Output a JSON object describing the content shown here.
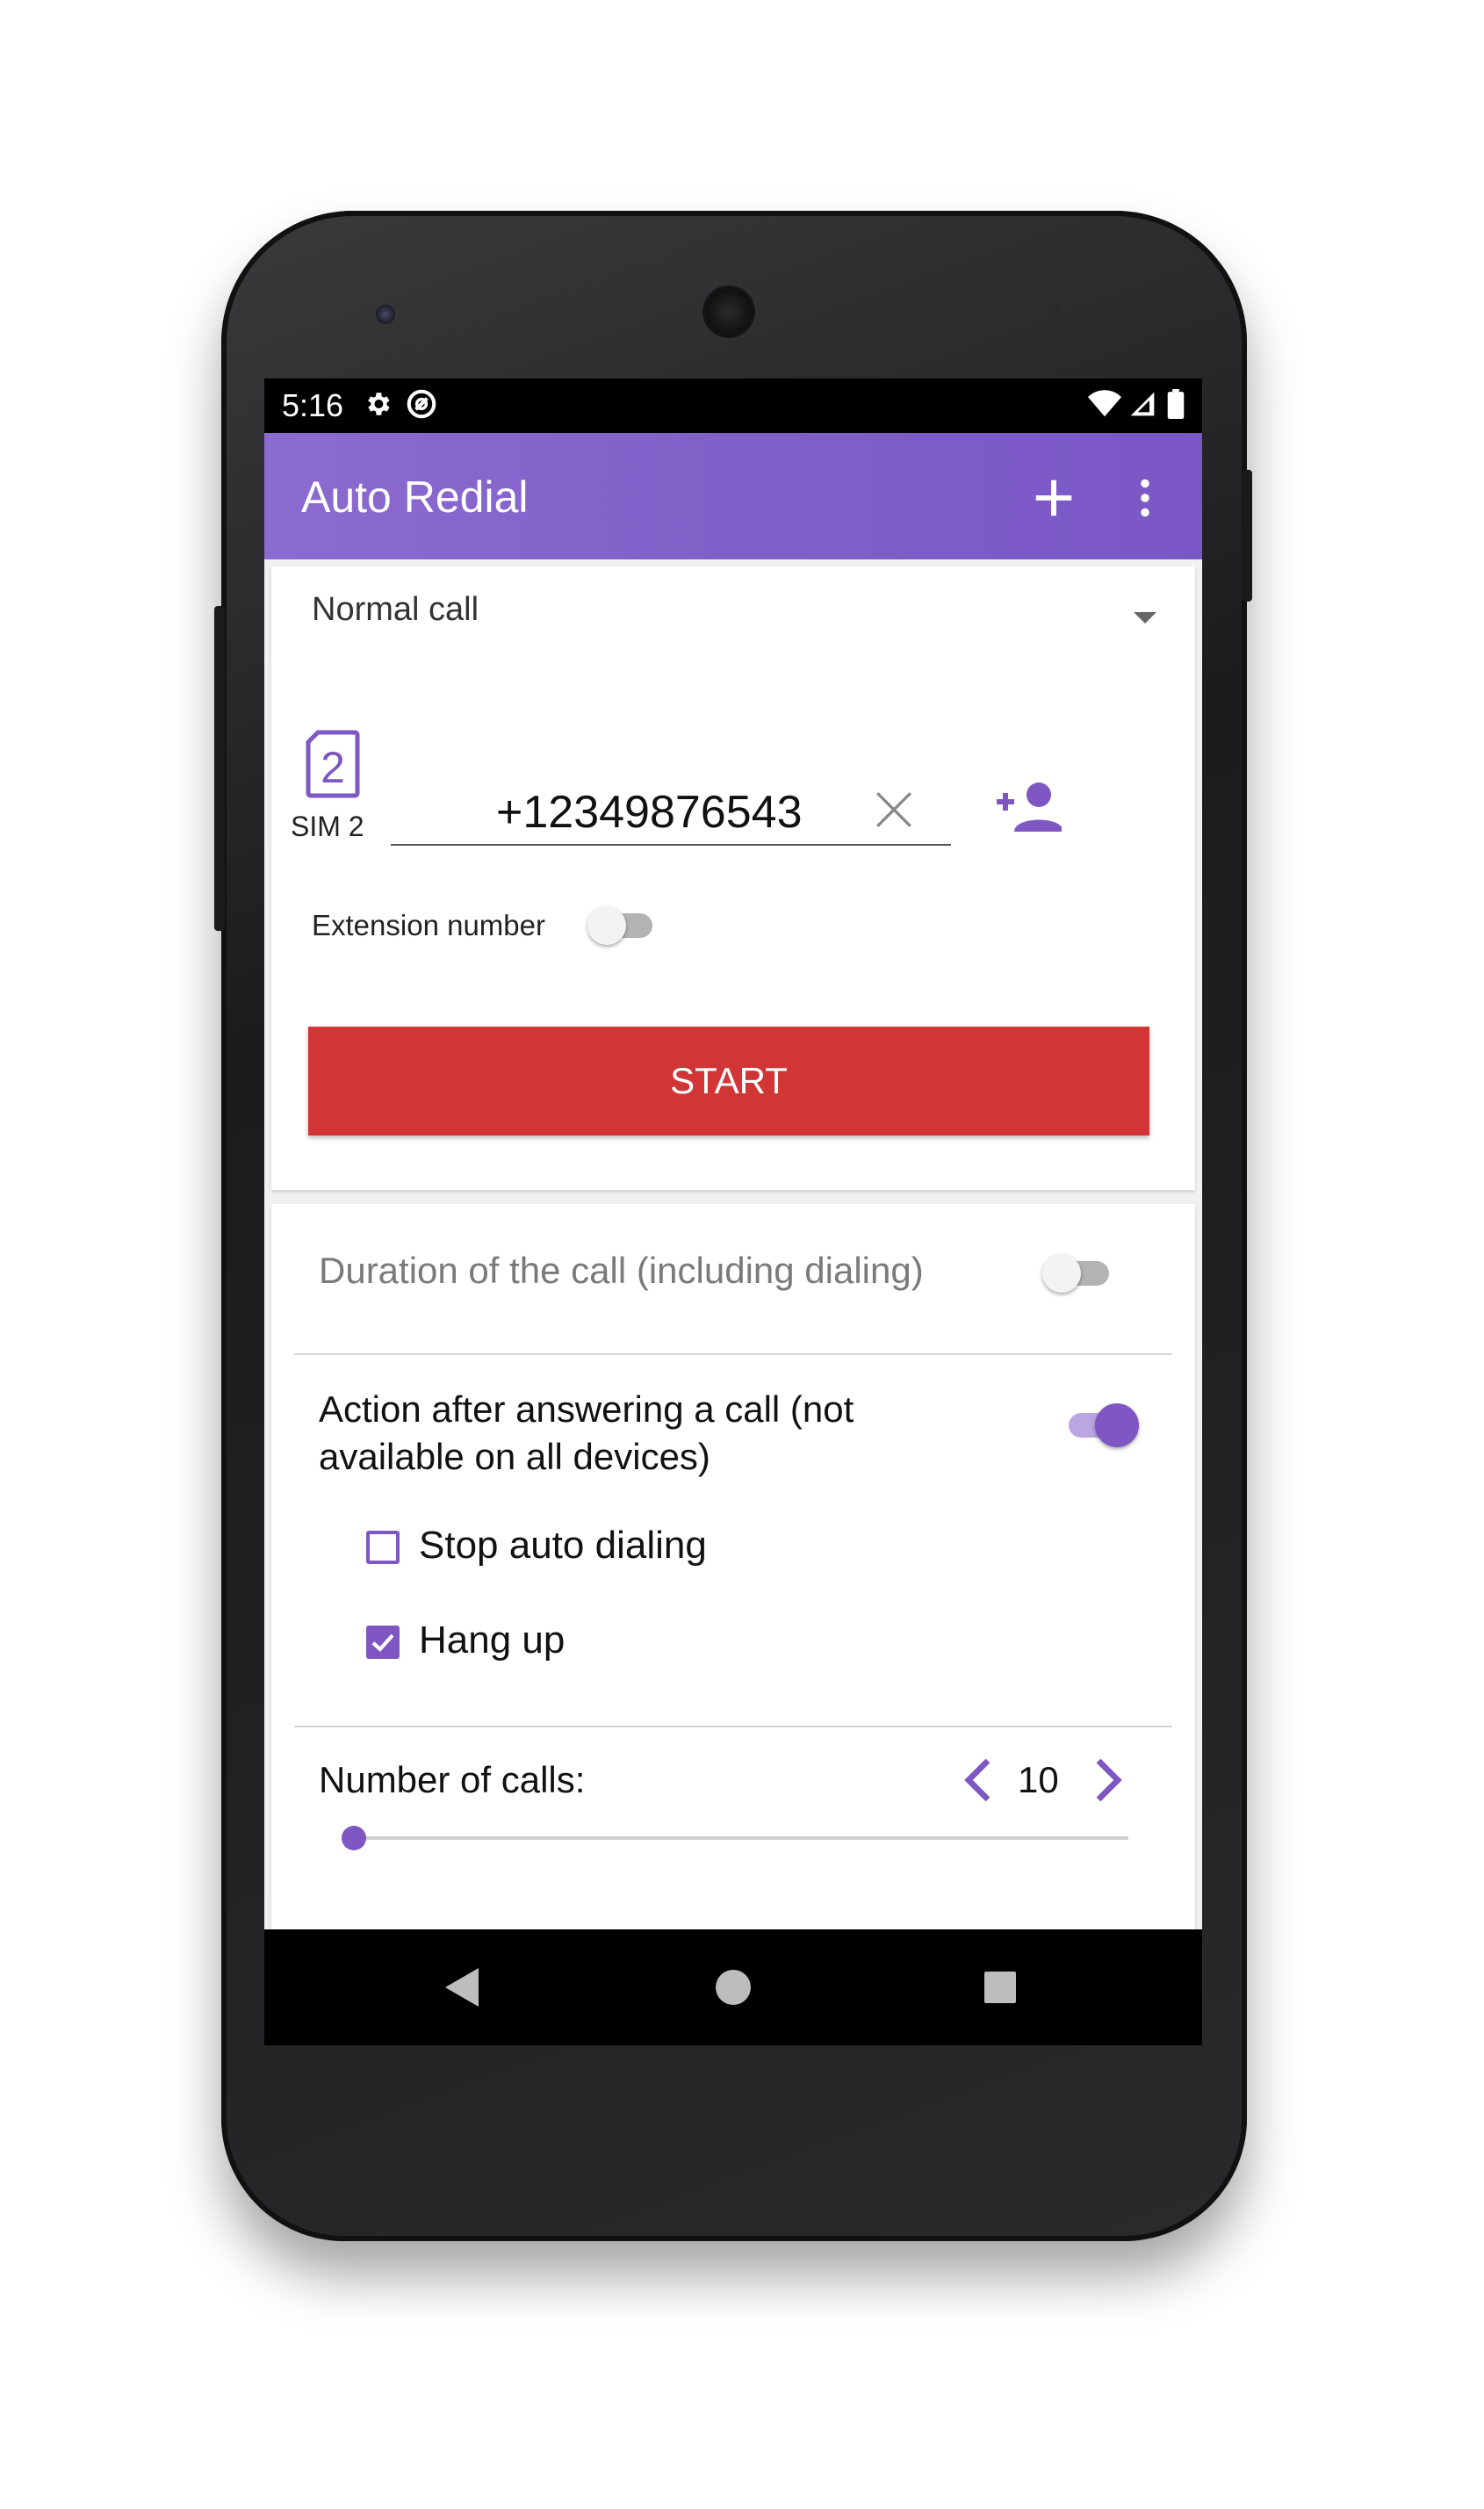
{
  "status_bar": {
    "time": "5:16"
  },
  "app_bar": {
    "title": "Auto Redial"
  },
  "call_type": {
    "selected": "Normal call"
  },
  "sim": {
    "label": "SIM 2",
    "badge": "2"
  },
  "phone_number": {
    "value": "+12349876543"
  },
  "extension": {
    "label": "Extension number",
    "enabled": false
  },
  "start_button": {
    "label": "START"
  },
  "duration": {
    "label": "Duration of the call (including dialing)",
    "enabled": false
  },
  "action_after_answer": {
    "label_line1": "Action after answering a call (not",
    "label_line2": "available on all devices)",
    "enabled": true,
    "options": [
      {
        "label": "Stop auto dialing",
        "checked": false
      },
      {
        "label": "Hang up",
        "checked": true
      }
    ]
  },
  "number_of_calls": {
    "label": "Number of calls:",
    "value": "10"
  },
  "colors": {
    "accent": "#7e57c2",
    "start": "#d23535"
  }
}
